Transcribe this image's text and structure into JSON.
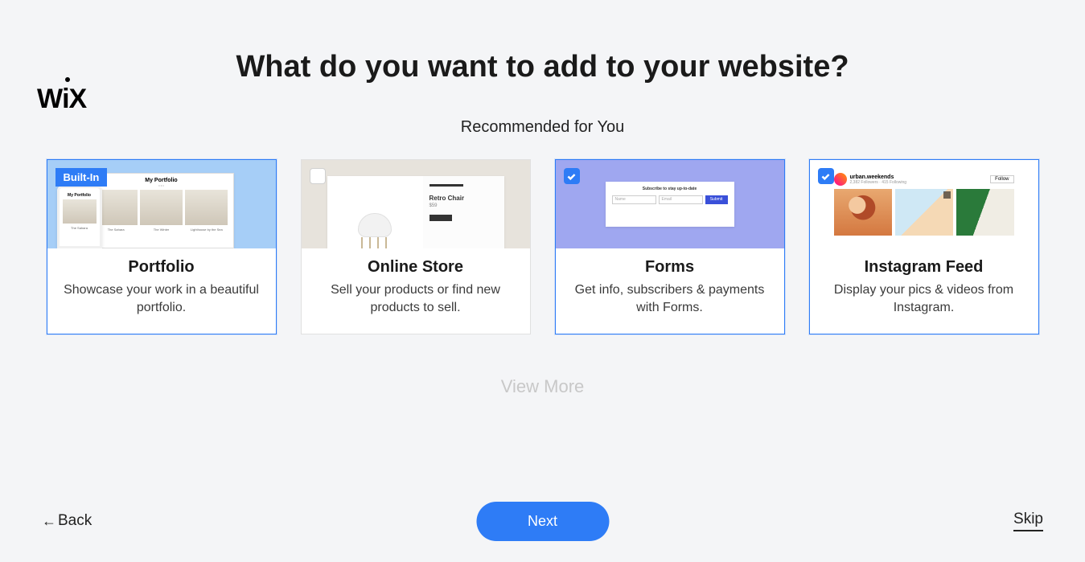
{
  "logo": "WiX",
  "heading": "What do you want to add to your website?",
  "subheading": "Recommended for You",
  "cards": [
    {
      "badge": "Built-In",
      "selected": true,
      "title": "Portfolio",
      "desc": "Showcase your work in a beautiful portfolio.",
      "preview": {
        "desktop_title": "My Portfolio",
        "captions": [
          "The Sahara",
          "The Winter",
          "Lighthouse by the Sea"
        ],
        "phone_title": "My Portfolio",
        "phone_caption": "The Sahara"
      }
    },
    {
      "selected": false,
      "title": "Online Store",
      "desc": "Sell your products or find new products to sell.",
      "preview": {
        "product_name": "Retro Chair",
        "price": "$59"
      }
    },
    {
      "selected": true,
      "title": "Forms",
      "desc": "Get info, subscribers & payments with Forms.",
      "preview": {
        "title": "Subscribe to stay up-to-date",
        "field1": "Name",
        "field2": "Email",
        "button": "Submit"
      }
    },
    {
      "selected": true,
      "title": "Instagram Feed",
      "desc": "Display your pics & videos from Instagram.",
      "preview": {
        "username": "urban.weekends",
        "meta": "2,382 Followers · 415 Following",
        "follow": "Follow"
      }
    }
  ],
  "view_more": "View More",
  "back": "Back",
  "next": "Next",
  "skip": "Skip"
}
